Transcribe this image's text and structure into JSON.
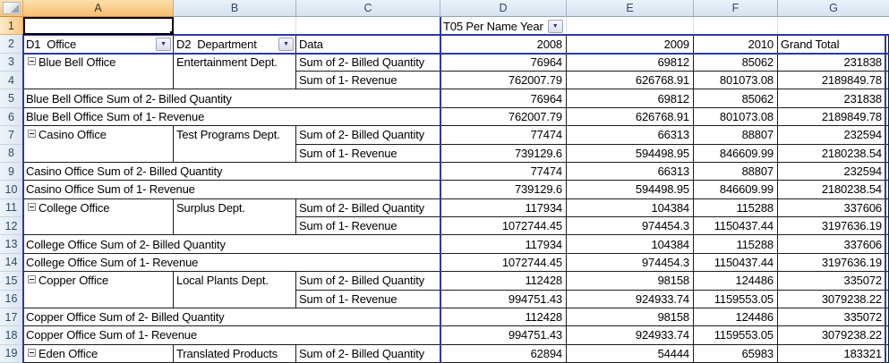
{
  "columns": {
    "letters": [
      "A",
      "B",
      "C",
      "D",
      "E",
      "F",
      "G"
    ],
    "selected": "A"
  },
  "rows": {
    "numbers": [
      "1",
      "2",
      "3",
      "4",
      "5",
      "6",
      "7",
      "8",
      "9",
      "10",
      "11",
      "12",
      "13",
      "14",
      "15",
      "16",
      "17",
      "18",
      "19"
    ],
    "selected": "1"
  },
  "active_cell": {
    "ref": "A1",
    "value": ""
  },
  "filter": {
    "label": "T05 Per Name Year",
    "icon": "dropdown"
  },
  "fields": {
    "office": "D1  Office",
    "department": "D2  Department",
    "data": "Data"
  },
  "years": {
    "y1": "2008",
    "y2": "2009",
    "y3": "2010",
    "grand": "Grand Total"
  },
  "measures": {
    "qty": "Sum of 2- Billed Quantity",
    "rev": "Sum of 1- Revenue"
  },
  "groups": [
    {
      "office": "Blue Bell Office",
      "department": "Entertainment Dept.",
      "qty": [
        "76964",
        "69812",
        "85062",
        "231838"
      ],
      "rev": [
        "762007.79",
        "626768.91",
        "801073.08",
        "2189849.78"
      ],
      "subtotal_qty": "Blue Bell Office Sum of 2- Billed Quantity",
      "subtotal_rev": "Blue Bell Office Sum of 1- Revenue"
    },
    {
      "office": "Casino Office",
      "department": "Test Programs Dept.",
      "qty": [
        "77474",
        "66313",
        "88807",
        "232594"
      ],
      "rev": [
        "739129.6",
        "594498.95",
        "846609.99",
        "2180238.54"
      ],
      "subtotal_qty": "Casino Office Sum of 2- Billed Quantity",
      "subtotal_rev": "Casino Office Sum of 1- Revenue"
    },
    {
      "office": "College Office",
      "department": "Surplus Dept.",
      "qty": [
        "117934",
        "104384",
        "115288",
        "337606"
      ],
      "rev": [
        "1072744.45",
        "974454.3",
        "1150437.44",
        "3197636.19"
      ],
      "subtotal_qty": "College Office Sum of 2- Billed Quantity",
      "subtotal_rev": "College Office Sum of 1- Revenue"
    },
    {
      "office": "Copper Office",
      "department": "Local Plants Dept.",
      "qty": [
        "112428",
        "98158",
        "124486",
        "335072"
      ],
      "rev": [
        "994751.43",
        "924933.74",
        "1159553.05",
        "3079238.22"
      ],
      "subtotal_qty": "Copper Office Sum of 2- Billed Quantity",
      "subtotal_rev": "Copper Office Sum of 1- Revenue"
    },
    {
      "office": "Eden Office",
      "department": "Translated Products",
      "qty": [
        "62894",
        "54444",
        "65983",
        "183321"
      ]
    }
  ],
  "colors": {
    "pivot_border_blue": "#2b3aa6",
    "selected_header_orange": "#f9bd70",
    "header_blue": "#d7e2f0"
  },
  "icons": {
    "dropdown": "▼",
    "collapse": "minus-box",
    "select_all": "corner-triangle"
  }
}
